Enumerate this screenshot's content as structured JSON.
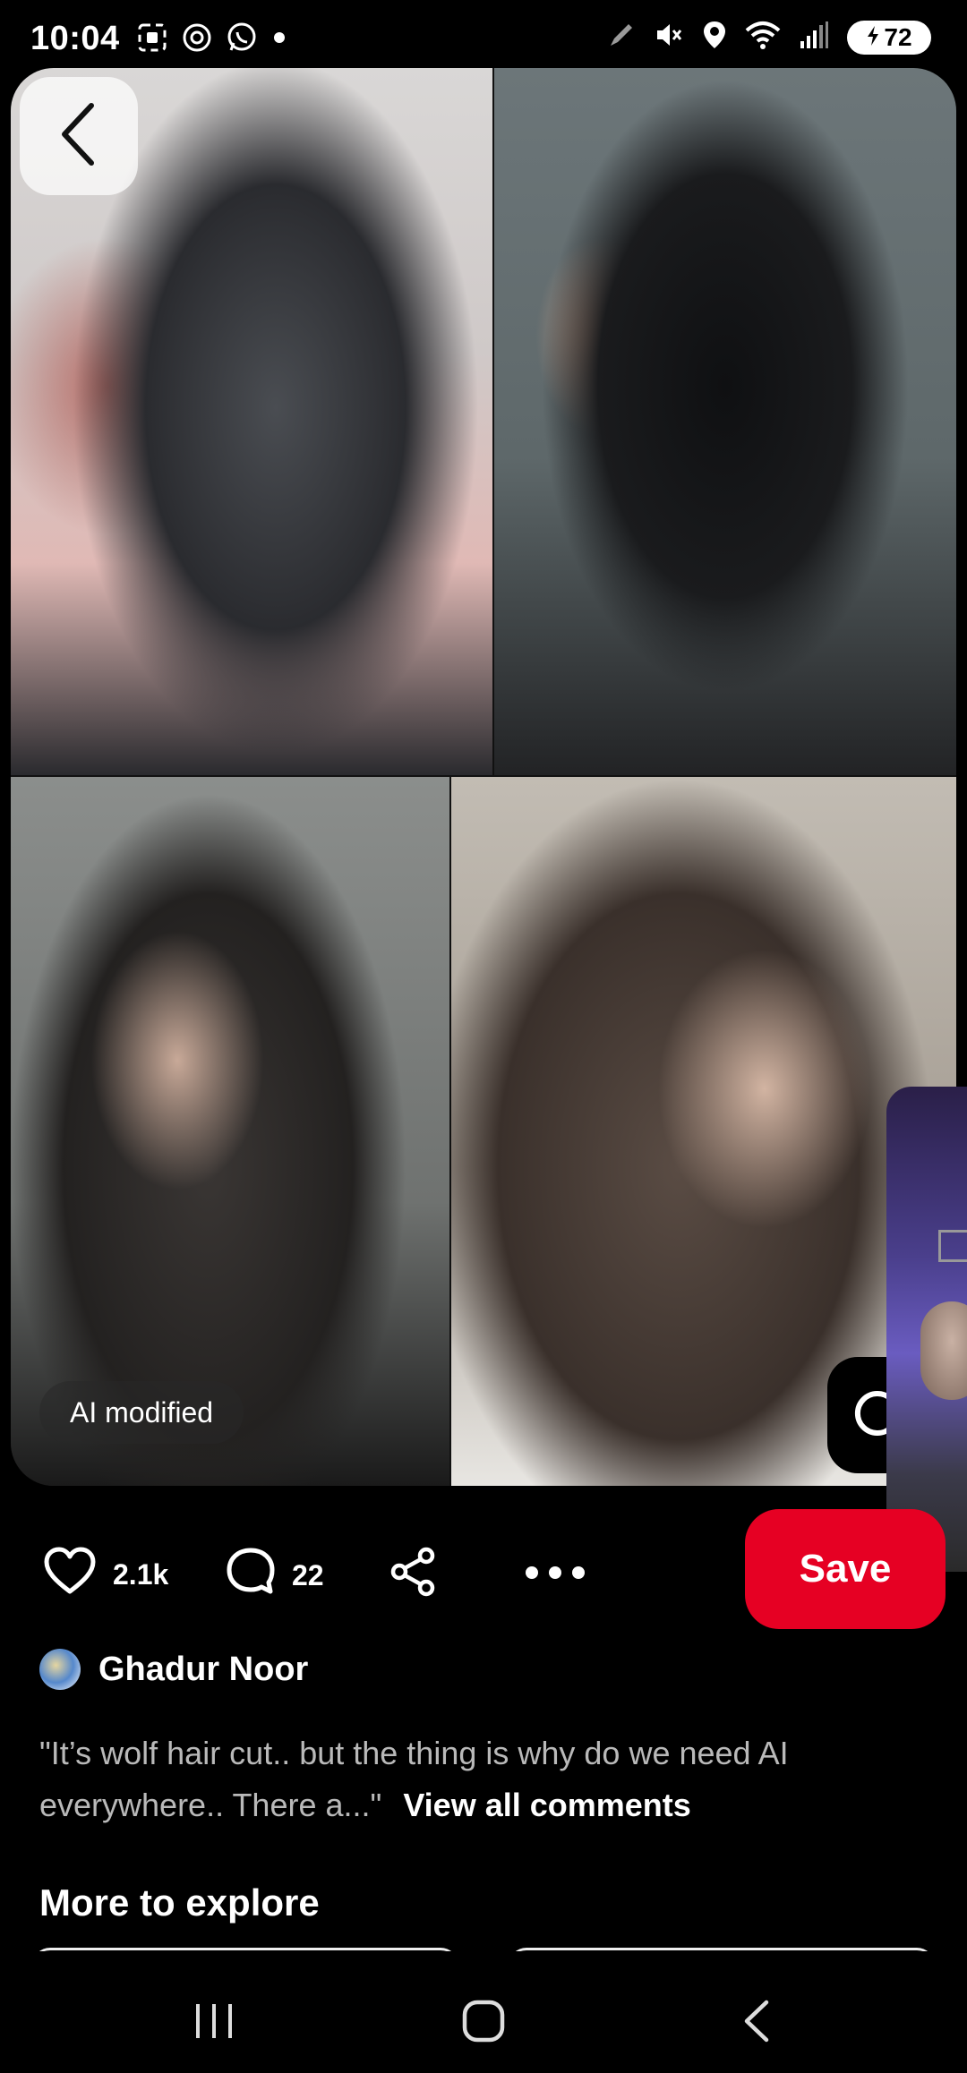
{
  "status_bar": {
    "time": "10:04",
    "battery": "72",
    "left_icons": [
      "screen-capture-icon",
      "threads-icon",
      "whatsapp-icon",
      "dot-icon"
    ],
    "right_icons": [
      "pen-icon",
      "mute-icon",
      "location-icon",
      "wifi-icon",
      "signal-icon",
      "battery-icon"
    ]
  },
  "pin": {
    "ai_badge": "AI modified",
    "back_icon": "chevron-left-icon",
    "lens_icon": "visual-search-icon"
  },
  "actions": {
    "likes": "2.1k",
    "comments": "22",
    "save_label": "Save",
    "icons": [
      "heart-icon",
      "comment-icon",
      "share-icon",
      "more-icon"
    ]
  },
  "creator": {
    "name": "Ghadur Noor"
  },
  "comment": {
    "text": "\"It’s wolf hair cut.. but the thing is why do we need AI everywhere.. There a...\"",
    "view_all": "View all comments"
  },
  "more_to_explore": {
    "title": "More to explore"
  },
  "nav": {
    "icons": [
      "recent-apps-icon",
      "home-icon",
      "back-icon"
    ]
  },
  "colors": {
    "accent": "#e60023",
    "background": "#000000"
  }
}
